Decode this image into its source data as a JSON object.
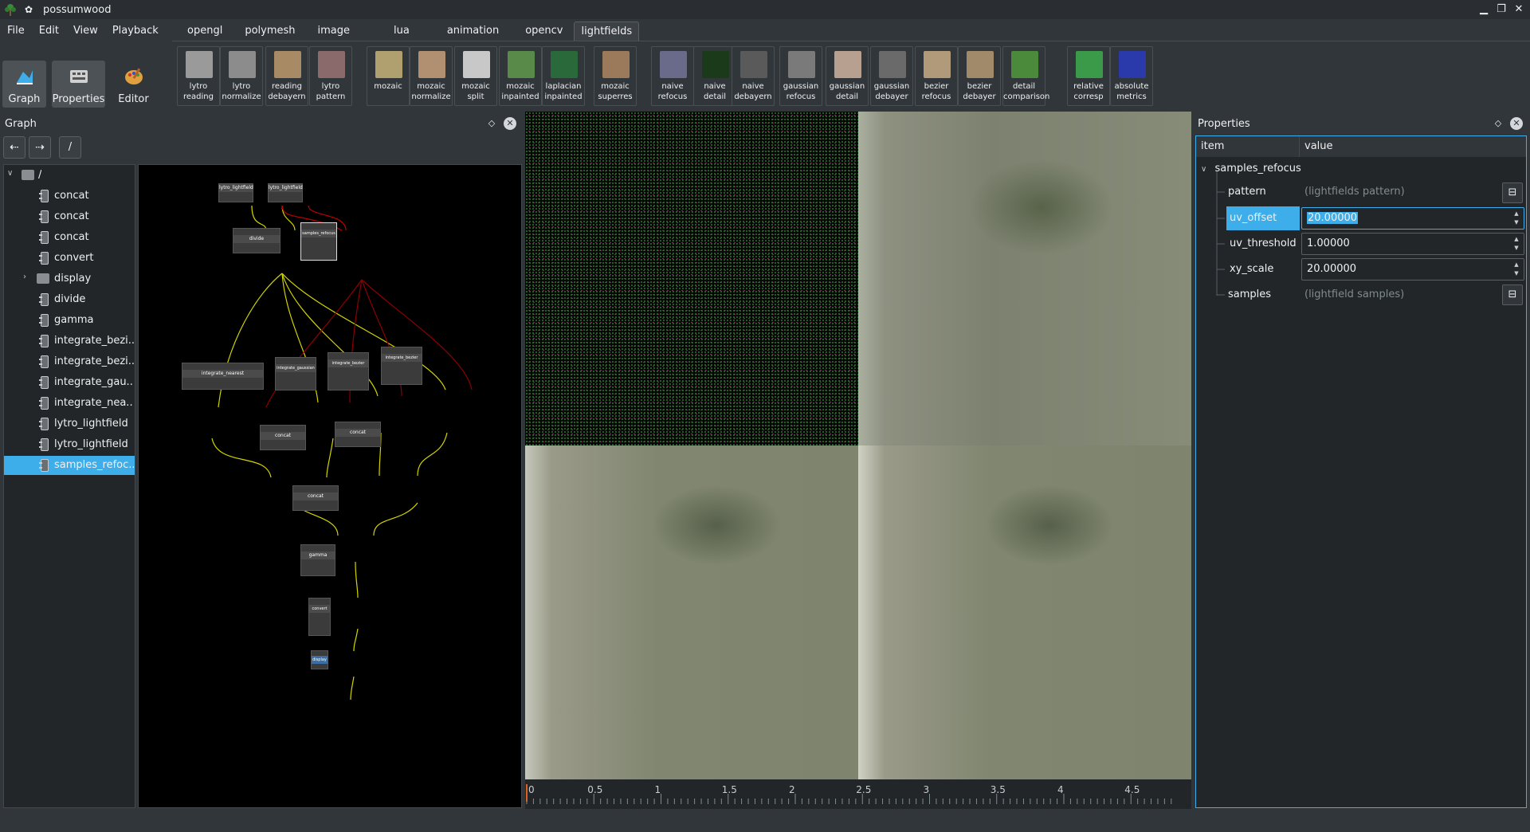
{
  "window": {
    "title": "possumwood"
  },
  "menu": [
    "File",
    "Edit",
    "View",
    "Playback"
  ],
  "modes": {
    "graph": "Graph",
    "properties": "Properties",
    "editor": "Editor"
  },
  "tabs": [
    "opengl",
    "polymesh",
    "image",
    "lua",
    "animation",
    "opencv",
    "lightfields"
  ],
  "active_tab": "lightfields",
  "tools": [
    {
      "label": "lytro\nreading",
      "color": "#9a9a9a"
    },
    {
      "label": "lytro\nnormalize",
      "color": "#8c8c8c"
    },
    {
      "label": "reading\ndebayern",
      "color": "#a88a64"
    },
    {
      "label": "lytro\npattern",
      "color": "#8a6a6a"
    },
    {
      "label": "mozaic",
      "color": "#b0a070"
    },
    {
      "label": "mozaic\nnormalize",
      "color": "#b09070"
    },
    {
      "label": "mozaic\nsplit",
      "color": "#c8c8c8"
    },
    {
      "label": "mozaic\ninpainted",
      "color": "#5a8a4a"
    },
    {
      "label": "laplacian\ninpainted",
      "color": "#2a6a3a"
    },
    {
      "label": "mozaic\nsuperres",
      "color": "#9a7a5a"
    },
    {
      "label": "naive\nrefocus",
      "color": "#6a6a8a"
    },
    {
      "label": "naive\ndetail",
      "color": "#1a3a1a"
    },
    {
      "label": "naive\ndebayern",
      "color": "#5a5a5a"
    },
    {
      "label": "gaussian\nrefocus",
      "color": "#7a7a7a"
    },
    {
      "label": "gaussian\ndetail",
      "color": "#b8a090"
    },
    {
      "label": "gaussian\ndebayer",
      "color": "#6a6a6a"
    },
    {
      "label": "bezier\nrefocus",
      "color": "#b09a7a"
    },
    {
      "label": "bezier\ndebayer",
      "color": "#a08a6a"
    },
    {
      "label": "detail\ncomparison",
      "color": "#4a8a3a"
    },
    {
      "label": "relative\ncorresp",
      "color": "#3a9a4a"
    },
    {
      "label": "absolute\nmetrics",
      "color": "#2a3aaa"
    }
  ],
  "graph_dock": {
    "title": "Graph",
    "path": "/"
  },
  "tree": {
    "root": "/",
    "items": [
      "concat",
      "concat",
      "concat",
      "convert",
      "display",
      "divide",
      "gamma",
      "integrate_bezi...",
      "integrate_bezi...",
      "integrate_gau...",
      "integrate_nea...",
      "lytro_lightfield",
      "lytro_lightfield",
      "samples_refoc..."
    ]
  },
  "graph_nodes": {
    "lytro1": "lytro_lightfield",
    "lytro2": "lytro_lightfield",
    "divide": "divide",
    "samples_refocus": "samples_refocus",
    "integrate_nearest": "integrate_nearest",
    "integrate_gaussian": "integrate_gaussian",
    "integrate_bezier1": "integrate_bezier",
    "integrate_bezier2": "integrate_bezier",
    "concat1": "concat",
    "concat2": "concat",
    "concat3": "concat",
    "gamma": "gamma",
    "convert": "convert",
    "display": "display"
  },
  "timeline": {
    "ticks": [
      "0",
      "0.5",
      "1",
      "1.5",
      "2",
      "2.5",
      "3",
      "3.5",
      "4",
      "4.5"
    ]
  },
  "properties": {
    "title": "Properties",
    "col_item": "item",
    "col_value": "value",
    "node": "samples_refocus",
    "rows": [
      {
        "name": "pattern",
        "value": "(lightfields pattern)"
      },
      {
        "name": "uv_offset",
        "value": "20.00000"
      },
      {
        "name": "uv_threshold",
        "value": "1.00000"
      },
      {
        "name": "xy_scale",
        "value": "20.00000"
      },
      {
        "name": "samples",
        "value": "(lightfield samples)"
      }
    ]
  }
}
